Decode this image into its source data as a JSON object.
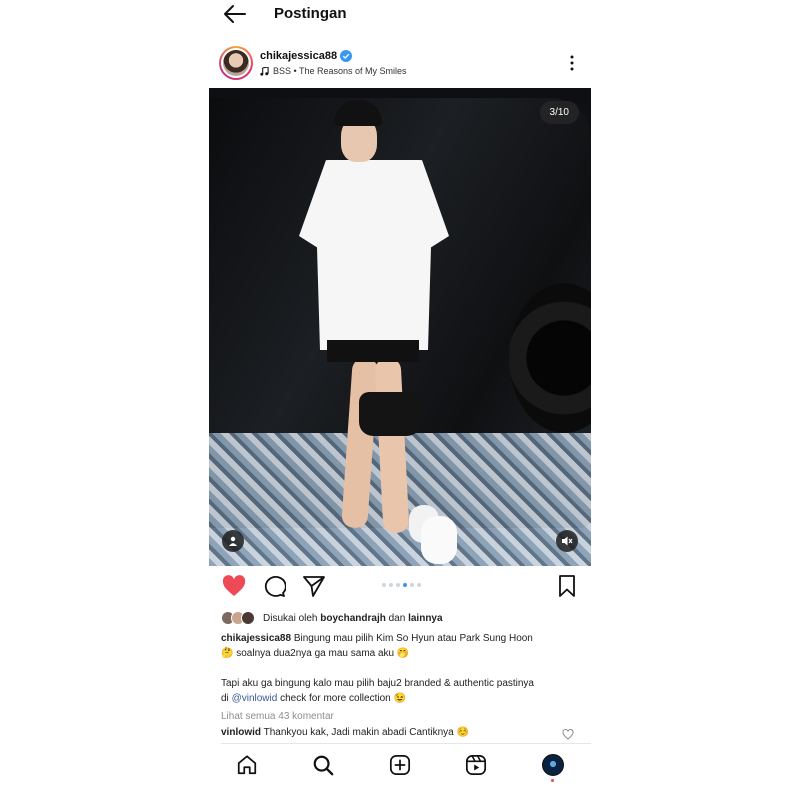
{
  "header": {
    "title": "Postingan"
  },
  "post": {
    "username": "chikajessica88",
    "music": "BSS • The Reasons of My Smiles",
    "media_counter": "3/10",
    "carousel": {
      "count": 6,
      "active_index": 3
    },
    "likes": {
      "prefix": "Disukai oleh",
      "user": "boychandrajh",
      "connector": "dan",
      "rest": "lainnya"
    },
    "caption": {
      "author": "chikajessica88",
      "line1": "Bingung mau pilih Kim So Hyun atau Park Sung Hoon",
      "line2": "🤔 soalnya dua2nya ga mau sama aku 🤭",
      "line3": "Tapi aku ga bingung kalo mau pilih baju2 branded & authentic pastinya",
      "line4_prefix": "di",
      "mention": "@vinlowid",
      "line4_suffix": "check for more collection 😉"
    },
    "view_comments": "Lihat semua 43 komentar",
    "comment": {
      "user": "vinlowid",
      "text": "Thankyou kak, Jadi makin abadi Cantiknya ☺️"
    }
  },
  "colors": {
    "like_red": "#ed4956",
    "verified_blue": "#3897f0",
    "mention_blue": "#385898"
  },
  "icons": {
    "back": "arrow-left-icon",
    "verified": "verified-badge-icon",
    "music": "music-note-icon",
    "more": "more-vertical-icon",
    "like": "heart-filled-icon",
    "comment": "comment-icon",
    "share": "send-icon",
    "save": "bookmark-icon",
    "home": "home-icon",
    "search": "search-icon",
    "new_post": "plus-square-icon",
    "reels": "reels-icon"
  }
}
